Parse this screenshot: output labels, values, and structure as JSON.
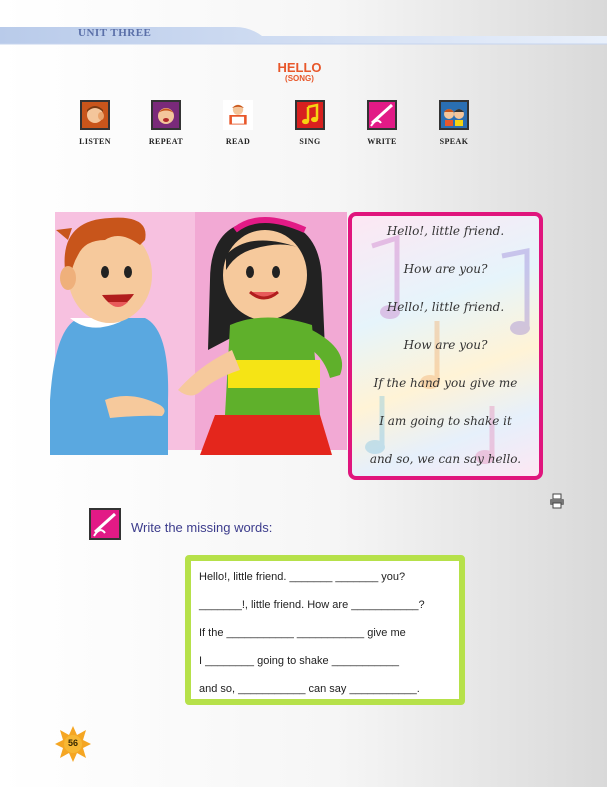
{
  "header": {
    "unit": "UNIT THREE"
  },
  "lesson": {
    "title": "HELLO",
    "subtitle": "(SONG)"
  },
  "skills": [
    "LISTEN",
    "REPEAT",
    "READ",
    "SING",
    "WRITE",
    "SPEAK"
  ],
  "song": {
    "lines": [
      "Hello!, little friend.",
      "How are you?",
      "Hello!, little friend.",
      "How are you?",
      "If the hand you give me",
      "I am going to shake it",
      "and so, we can say hello."
    ]
  },
  "exercise": {
    "instruction": "Write the missing words:",
    "lines": [
      "Hello!, little friend.   _______   _______ you?",
      "_______!, little friend. How are ___________?",
      "If the ___________   ___________ give me",
      "I ________ going to shake ___________",
      "and so, ___________ can say ___________."
    ]
  },
  "page": {
    "number": "56"
  },
  "colors": {
    "accent": "#e8572a",
    "frame": "#e0157d",
    "exercise_border": "#b6e14a",
    "instruction_text": "#3c3c8c"
  },
  "icons": [
    "printer-icon",
    "write-icon",
    "page-number-badge"
  ]
}
